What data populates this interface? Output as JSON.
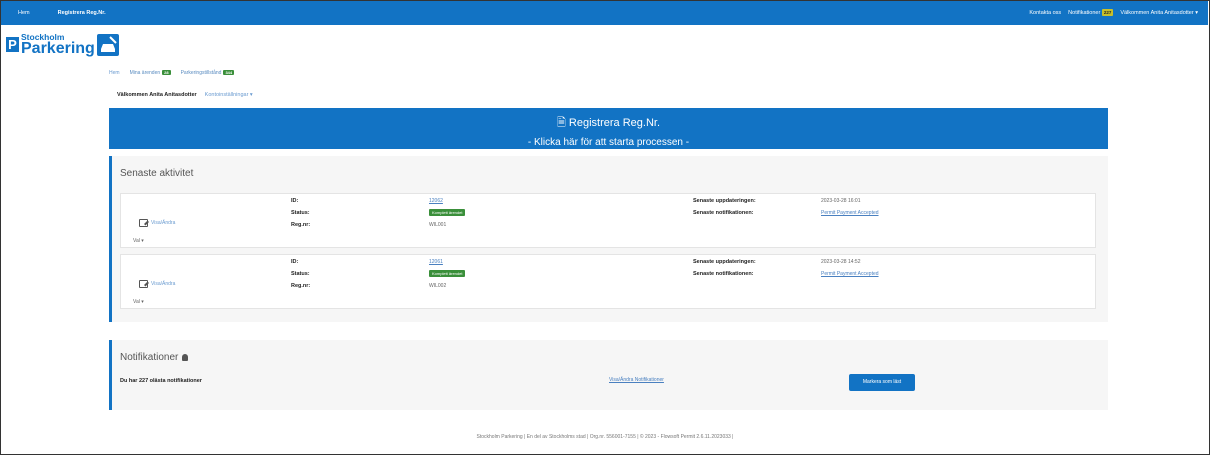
{
  "topbar": {
    "home": "Hem",
    "crumb": "Registrera Reg.Nr.",
    "contact": "Kontakta oss",
    "notifications_label": "Notifikationer",
    "notifications_count": "227",
    "welcome": "Välkommen Anita Anitasdotter ▾"
  },
  "logo": {
    "line1": "Stockholm",
    "line2": "Parkering"
  },
  "tabs": [
    {
      "label": "Hem"
    },
    {
      "label": "Mina ärenden",
      "count": "28"
    },
    {
      "label": "Parkeringstillstånd",
      "count": "344"
    }
  ],
  "welcome": {
    "name": "Välkommen Anita Anitasdotter",
    "menu": "Kontoinställningar ▾"
  },
  "banner": {
    "title": "Registrera Reg.Nr.",
    "subtitle": "- Klicka här för att starta processen -"
  },
  "activity": {
    "title": "Senaste aktivitet",
    "labels": {
      "id": "ID:",
      "status": "Status:",
      "reg": "Reg.nr:",
      "updated": "Senaste uppdateringen:",
      "notif": "Senaste notifikationen:",
      "view": "Visa/Ändra",
      "val": "Val ▾"
    },
    "items": [
      {
        "id": "12062",
        "status": "Komplett ärendet",
        "reg": "WIL001",
        "updated": "2023-03-28 16:01",
        "notif": "Permit Payment Accepted"
      },
      {
        "id": "12061",
        "status": "Komplett ärendet",
        "reg": "WIL002",
        "updated": "2023-03-28 14:52",
        "notif": "Permit Payment Accepted"
      }
    ]
  },
  "notifications": {
    "title": "Notifikationer",
    "message": "Du har 227 olästa notifikationer",
    "link": "Visa/Ändra Notifikationer",
    "button": "Markera som läst"
  },
  "footer": "Stockholm Parkering | En del av Stockholms stad | Org.nr. 556001-7155 | © 2023 - Flowsoft Permit 2.6.11.2023033 |"
}
